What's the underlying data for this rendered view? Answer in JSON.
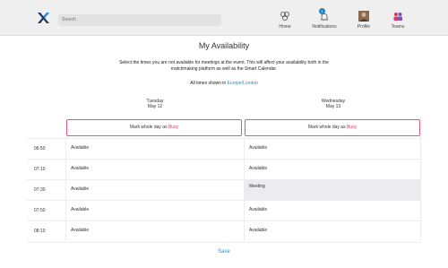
{
  "header": {
    "search_placeholder": "Search",
    "nav": [
      {
        "label": "Home",
        "icon": "home-icon"
      },
      {
        "label": "Notifications",
        "icon": "bell-icon",
        "badge": "1"
      },
      {
        "label": "Profile",
        "icon": "profile-photo-icon"
      },
      {
        "label": "Teams",
        "icon": "teams-icon"
      }
    ]
  },
  "page": {
    "title": "My Availability",
    "description": "Select the times you are not available for meetings at the event. This will affect your availability both in the matchmaking platform as well as the Smart Calendar.",
    "timezone_prefix": "All times shown in",
    "timezone": "Europe/London"
  },
  "days": [
    {
      "weekday": "Tuesday",
      "date": "May 12",
      "busy_prefix": "Mark whole day as",
      "busy_word": "Busy"
    },
    {
      "weekday": "Wednesday",
      "date": "May 13",
      "busy_prefix": "Mark whole day as",
      "busy_word": "Busy"
    }
  ],
  "slots": [
    {
      "time": "06:50",
      "day1": "Available",
      "day2": "Available"
    },
    {
      "time": "07:10",
      "day1": "Available",
      "day2": "Available"
    },
    {
      "time": "07:30",
      "day1": "Available",
      "day2": "Meeting"
    },
    {
      "time": "07:50",
      "day1": "Available",
      "day2": "Available"
    },
    {
      "time": "08:10",
      "day1": "Available",
      "day2": "Available"
    }
  ],
  "footer": {
    "save_label": "Save"
  },
  "colors": {
    "accent": "#2a8fd0",
    "busy": "#e0355f",
    "busy_border": "#e9557a",
    "meeting_bg": "#ebebf0"
  }
}
